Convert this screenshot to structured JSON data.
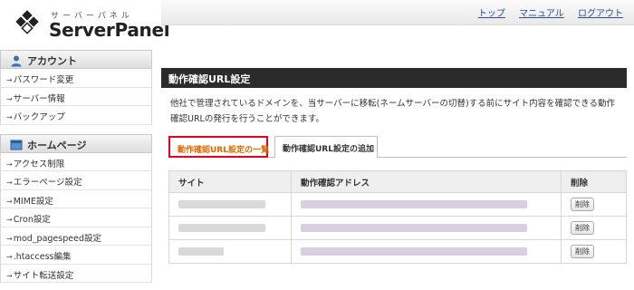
{
  "header": {
    "logo_kana": "サーバーパネル",
    "logo_text": "ServerPanel",
    "links": [
      "トップ",
      "マニュアル",
      "ログアウト"
    ]
  },
  "sidebar": {
    "sections": [
      {
        "title": "アカウント",
        "icon": "user-icon",
        "items": [
          "パスワード変更",
          "サーバー情報",
          "バックアップ"
        ]
      },
      {
        "title": "ホームページ",
        "icon": "homepage-icon",
        "items": [
          "アクセス制限",
          "エラーページ設定",
          "MIME設定",
          "Cron設定",
          "mod_pagespeed設定",
          ".htaccess編集",
          "サイト転送設定"
        ]
      }
    ]
  },
  "main": {
    "title": "動作確認URL設定",
    "description": "他社で管理されているドメインを、当サーバーに移転(ネームサーバーの切替)する前にサイト内容を確認できる動作確認URLの発行を行うことができます。",
    "tabs": [
      "動作確認URL設定の一覧",
      "動作確認URL設定の追加"
    ],
    "table": {
      "headers": [
        "サイト",
        "動作確認アドレス",
        "削除"
      ],
      "rows": [
        {
          "delete_label": "削除"
        },
        {
          "delete_label": "削除"
        },
        {
          "delete_label": "削除"
        }
      ]
    }
  },
  "colors": {
    "title_bar": "#2b2b2b",
    "active_tab_border": "#e8001c",
    "active_tab_text": "#e06a00",
    "link": "#2a4d9c"
  }
}
